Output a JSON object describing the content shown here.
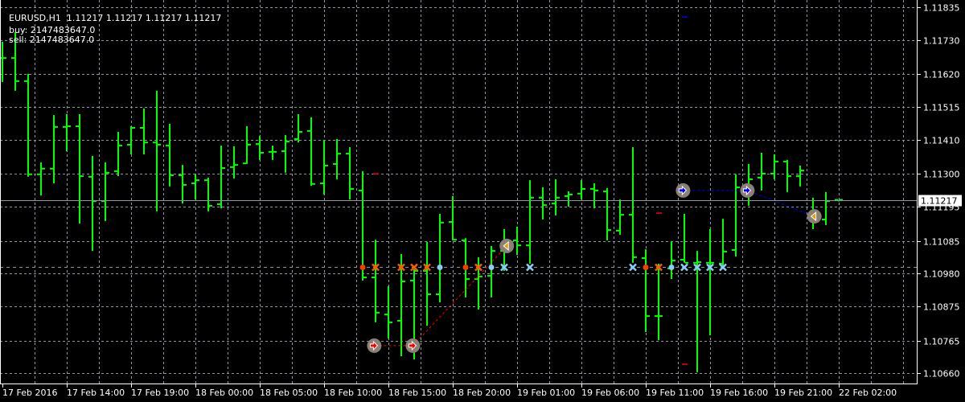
{
  "header": {
    "symbol": "EURUSD,H1",
    "ohlc": "1.11217 1.11217 1.11217 1.11217",
    "buy": "buy: 2147483647.0",
    "sell": "sell: 2147483647.0"
  },
  "colors": {
    "background": "#000000",
    "bar": "#00ff00",
    "grid": "#8c96a0",
    "priceLine": "#8c96a0",
    "signal": "#8a8075",
    "buyLine": "#ff0000",
    "sellLine": "#0000ff",
    "orangeX": "#ff5a00",
    "lightBlue": "#87cefa",
    "redDot": "#ff3c00"
  },
  "current_price": "1.11217",
  "chart_data": {
    "type": "ohlc",
    "price_ticks": [
      "1.11835",
      "1.11730",
      "1.11620",
      "1.11515",
      "1.11410",
      "1.11300",
      "1.11195",
      "1.11085",
      "1.10980",
      "1.10875",
      "1.10765",
      "1.10660"
    ],
    "time_labels": [
      "17 Feb 2016",
      "17 Feb 14:00",
      "17 Feb 19:00",
      "18 Feb 00:00",
      "18 Feb 05:00",
      "18 Feb 10:00",
      "18 Feb 15:00",
      "18 Feb 20:00",
      "19 Feb 01:00",
      "19 Feb 06:00",
      "19 Feb 11:00",
      "19 Feb 16:00",
      "19 Feb 21:00",
      "22 Feb 02:00"
    ],
    "ylim": [
      1.1066,
      1.11835
    ],
    "bars_ohlc": [
      [
        1.11672,
        1.11724,
        1.11595,
        1.11672
      ],
      [
        1.11672,
        1.11755,
        1.11567,
        1.11598
      ],
      [
        1.11598,
        1.11621,
        1.11291,
        1.11299
      ],
      [
        1.11299,
        1.11337,
        1.11231,
        1.11317
      ],
      [
        1.11317,
        1.11489,
        1.1127,
        1.11451
      ],
      [
        1.11451,
        1.11492,
        1.11373,
        1.11453
      ],
      [
        1.11453,
        1.11492,
        1.11141,
        1.11293
      ],
      [
        1.11291,
        1.11358,
        1.11053,
        1.11213
      ],
      [
        1.11213,
        1.11337,
        1.11149,
        1.11304
      ],
      [
        1.11309,
        1.11435,
        1.11293,
        1.11391
      ],
      [
        1.11394,
        1.11453,
        1.11363,
        1.11448
      ],
      [
        1.11448,
        1.1151,
        1.11363,
        1.11401
      ],
      [
        1.11401,
        1.11567,
        1.1118,
        1.11394
      ],
      [
        1.11391,
        1.11461,
        1.1126,
        1.11296
      ],
      [
        1.11296,
        1.11329,
        1.11205,
        1.11265
      ],
      [
        1.1127,
        1.11299,
        1.11218,
        1.1128
      ],
      [
        1.1128,
        1.11288,
        1.1118,
        1.11198
      ],
      [
        1.11203,
        1.11391,
        1.1119,
        1.11319
      ],
      [
        1.11322,
        1.11389,
        1.11285,
        1.11329
      ],
      [
        1.11334,
        1.11453,
        1.11332,
        1.11394
      ],
      [
        1.11396,
        1.11422,
        1.11345,
        1.11368
      ],
      [
        1.11371,
        1.11391,
        1.11345,
        1.11371
      ],
      [
        1.11373,
        1.11425,
        1.11304,
        1.11404
      ],
      [
        1.11412,
        1.11492,
        1.11401,
        1.11435
      ],
      [
        1.11438,
        1.11482,
        1.11262,
        1.11268
      ],
      [
        1.1127,
        1.11409,
        1.11234,
        1.11327
      ],
      [
        1.11332,
        1.11412,
        1.11283,
        1.11365
      ],
      [
        1.11365,
        1.11386,
        1.11218,
        1.11252
      ],
      [
        1.11247,
        1.11309,
        1.10958,
        1.10968
      ],
      [
        1.10968,
        1.11089,
        1.10824,
        1.10855
      ],
      [
        1.10849,
        1.1094,
        1.10772,
        1.10824
      ],
      [
        1.10829,
        1.11043,
        1.10715,
        1.10955
      ],
      [
        1.10958,
        1.10994,
        1.10705,
        1.10989
      ],
      [
        1.10989,
        1.11082,
        1.10813,
        1.10914
      ],
      [
        1.10914,
        1.11172,
        1.10888,
        1.11144
      ],
      [
        1.11146,
        1.11229,
        1.11087,
        1.11089
      ],
      [
        1.11087,
        1.11094,
        1.10904,
        1.10963
      ],
      [
        1.10963,
        1.11033,
        1.10865,
        1.10971
      ],
      [
        1.10973,
        1.11069,
        1.10904,
        1.11053
      ],
      [
        1.11053,
        1.11123,
        1.10989,
        1.11084
      ],
      [
        1.11087,
        1.11131,
        1.1104,
        1.11071
      ],
      [
        1.11071,
        1.1128,
        1.11012,
        1.11224
      ],
      [
        1.11224,
        1.11257,
        1.11154,
        1.112
      ],
      [
        1.11205,
        1.11283,
        1.11167,
        1.11224
      ],
      [
        1.11229,
        1.11244,
        1.11195,
        1.11234
      ],
      [
        1.11237,
        1.1128,
        1.11218,
        1.11252
      ],
      [
        1.11252,
        1.1127,
        1.1119,
        1.11247
      ],
      [
        1.11244,
        1.11255,
        1.11087,
        1.1112
      ],
      [
        1.11118,
        1.11218,
        1.11105,
        1.11169
      ],
      [
        1.11169,
        1.11386,
        1.11015,
        1.11033
      ],
      [
        1.1103,
        1.11058,
        1.10793,
        1.10844
      ],
      [
        1.10844,
        1.11012,
        1.10767,
        1.10844
      ],
      [
        1.10997,
        1.11084,
        1.10963,
        1.11022
      ],
      [
        1.11025,
        1.11172,
        1.11015,
        1.11015
      ],
      [
        1.11015,
        1.11053,
        1.10664,
        1.11017
      ],
      [
        1.11015,
        1.11123,
        1.10782,
        1.11015
      ],
      [
        1.11012,
        1.11156,
        1.10999,
        1.11051
      ],
      [
        1.11056,
        1.11299,
        1.11035,
        1.11257
      ],
      [
        1.11247,
        1.11332,
        1.11198,
        1.11283
      ],
      [
        1.11288,
        1.11368,
        1.11247,
        1.11301
      ],
      [
        1.11301,
        1.11363,
        1.11283,
        1.1134
      ],
      [
        1.1134,
        1.11345,
        1.11242,
        1.11293
      ],
      [
        1.11293,
        1.11327,
        1.1126,
        1.11311
      ],
      [
        1.11162,
        1.11224,
        1.11123,
        1.11162
      ],
      [
        1.11154,
        1.11242,
        1.11136,
        1.11213
      ],
      [
        1.11217,
        1.11217,
        1.11217,
        1.11217
      ]
    ],
    "level_price": 1.11002,
    "level_markers": [
      {
        "bar": 28,
        "kind": "red-dot"
      },
      {
        "bar": 29,
        "kind": "orange-x"
      },
      {
        "bar": 31,
        "kind": "orange-x"
      },
      {
        "bar": 32,
        "kind": "orange-x"
      },
      {
        "bar": 33,
        "kind": "orange-x"
      },
      {
        "bar": 34,
        "kind": "blue-dot"
      },
      {
        "bar": 36,
        "kind": "red-dot"
      },
      {
        "bar": 37,
        "kind": "orange-x"
      },
      {
        "bar": 38,
        "kind": "blue-dot"
      },
      {
        "bar": 39,
        "kind": "blue-x"
      },
      {
        "bar": 41,
        "kind": "blue-x"
      },
      {
        "bar": 49,
        "kind": "blue-x"
      },
      {
        "bar": 50,
        "kind": "red-dot"
      },
      {
        "bar": 51,
        "kind": "orange-x"
      },
      {
        "bar": 52,
        "kind": "blue-dot"
      },
      {
        "bar": 53,
        "kind": "blue-x"
      },
      {
        "bar": 54,
        "kind": "blue-x"
      },
      {
        "bar": 55,
        "kind": "blue-x"
      },
      {
        "bar": 56,
        "kind": "blue-x"
      }
    ],
    "trades": [
      {
        "side": "buy",
        "color": "#ff0000",
        "points": [
          {
            "bar": 28.9,
            "price": 1.10749,
            "icon": "right-arrow"
          },
          {
            "bar": 31.9,
            "price": 1.10749,
            "icon": "right-arrow"
          },
          {
            "bar": 39.2,
            "price": 1.11069,
            "icon": "left-triangle"
          }
        ]
      },
      {
        "side": "sell",
        "color": "#0000ff",
        "points": [
          {
            "bar": 52.9,
            "price": 1.11247,
            "icon": "right-arrow"
          },
          {
            "bar": 57.9,
            "price": 1.11247,
            "icon": "right-arrow"
          },
          {
            "bar": 63.1,
            "price": 1.11164,
            "icon": "left-triangle"
          }
        ]
      }
    ],
    "dashes": [
      {
        "bar": 29,
        "price": 1.11301,
        "color": "#ff0000"
      },
      {
        "bar": 51,
        "price": 1.11175,
        "color": "#ff0000"
      },
      {
        "bar": 53,
        "price": 1.1069,
        "color": "#ff0000"
      },
      {
        "bar": 53,
        "price": 1.11804,
        "color": "#0000ff"
      }
    ]
  }
}
